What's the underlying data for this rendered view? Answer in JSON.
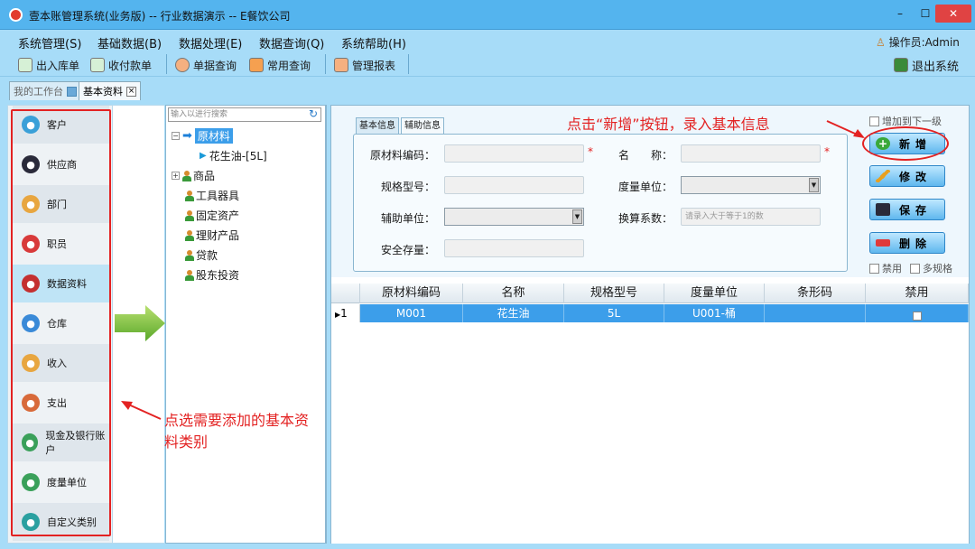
{
  "window": {
    "title": "壹本账管理系统(业务版) -- 行业数据演示 -- E餐饮公司",
    "min": "–",
    "max": "☐",
    "close": "✕"
  },
  "menubar": {
    "items": [
      "系统管理(S)",
      "基础数据(B)",
      "数据处理(E)",
      "数据查询(Q)",
      "系统帮助(H)"
    ],
    "operator": "操作员:Admin"
  },
  "toolbar": {
    "items": [
      "出入库单",
      "收付款单",
      "单据查询",
      "常用查询",
      "管理报表"
    ],
    "exit": "退出系统"
  },
  "tabs": {
    "workbench": "我的工作台",
    "basic": "基本资料",
    "close": "×"
  },
  "categories": [
    {
      "label": "客户",
      "icon": "customer-icon",
      "color": "#3aa0d8"
    },
    {
      "label": "供应商",
      "icon": "supplier-icon",
      "color": "#2a2a3a"
    },
    {
      "label": "部门",
      "icon": "department-icon",
      "color": "#e8a640"
    },
    {
      "label": "职员",
      "icon": "employee-icon",
      "color": "#d83a3a"
    },
    {
      "label": "数据资料",
      "icon": "data-icon",
      "color": "#c43030"
    },
    {
      "label": "仓库",
      "icon": "warehouse-icon",
      "color": "#3a8ad8"
    },
    {
      "label": "收入",
      "icon": "income-icon",
      "color": "#e8a640"
    },
    {
      "label": "支出",
      "icon": "expense-icon",
      "color": "#d86a3a"
    },
    {
      "label": "现金及银行账户",
      "icon": "bank-icon",
      "color": "#3aa05a"
    },
    {
      "label": "度量单位",
      "icon": "unit-icon",
      "color": "#3aa05a"
    },
    {
      "label": "自定义类别",
      "icon": "custom-icon",
      "color": "#2aa0a0"
    }
  ],
  "tree": {
    "search_placeholder": "输入以进行搜索",
    "root": "原材料",
    "child": "花生油-[5L]",
    "nodes": [
      "商品",
      "工具器具",
      "固定资产",
      "理财产品",
      "贷款",
      "股东投资"
    ]
  },
  "form": {
    "subtabs": [
      "基本信息",
      "辅助信息"
    ],
    "labels": {
      "code": "原材料编码：",
      "spec": "规格型号：",
      "aux_unit": "辅助单位：",
      "safety": "安全存量：",
      "name": "名　　称：",
      "unit": "度量单位：",
      "ratio": "换算系数："
    },
    "ratio_placeholder": "请录入大于等于1的数",
    "required_mark": "*"
  },
  "actions": {
    "add_next_level": "增加到下一级",
    "new": "新增",
    "edit": "修改",
    "save": "保存",
    "delete": "删除",
    "disabled": "禁用",
    "multi_spec": "多规格"
  },
  "annotations": {
    "top": "点击“新增”按钮，录入基本信息",
    "left": "点选需要添加的基本资料类别"
  },
  "grid": {
    "columns": [
      "原材料编码",
      "名称",
      "规格型号",
      "度量单位",
      "条形码",
      "禁用"
    ],
    "rows": [
      {
        "index": "1",
        "code": "M001",
        "name": "花生油",
        "spec": "5L",
        "unit": "U001-桶",
        "barcode": "",
        "disabled": false
      }
    ]
  }
}
